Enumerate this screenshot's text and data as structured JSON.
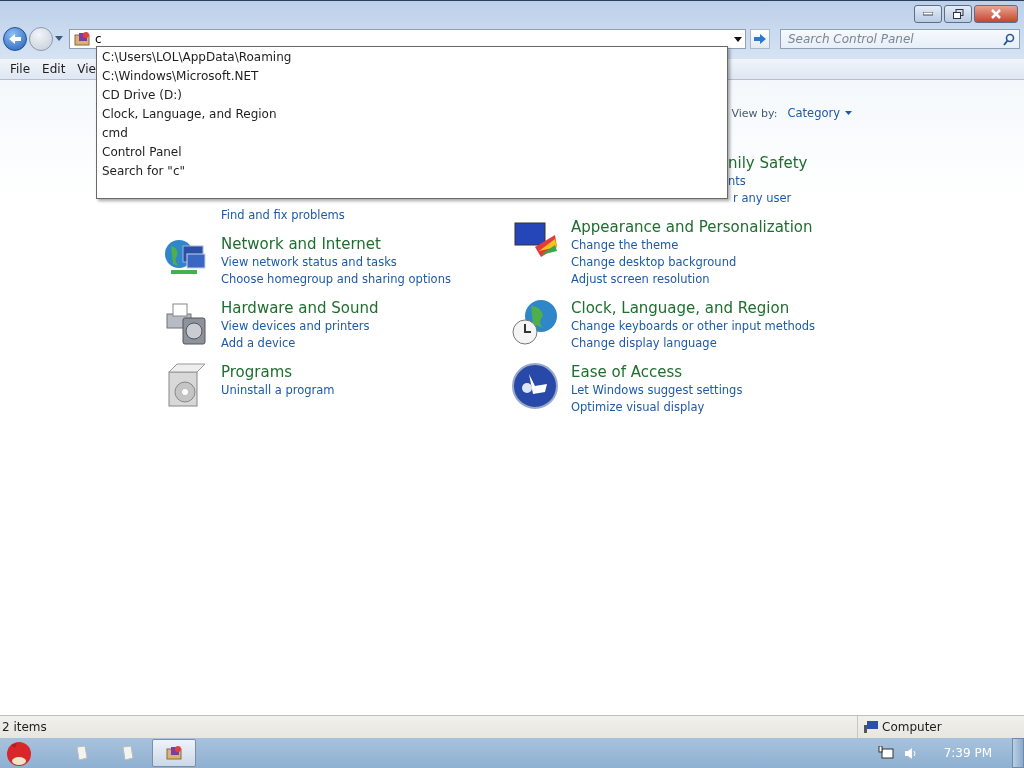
{
  "address_bar": {
    "value": "c",
    "suggestions": [
      "C:\\Users\\LOL\\AppData\\Roaming",
      "C:\\Windows\\Microsoft.NET",
      "CD Drive (D:)",
      "Clock, Language, and Region",
      "cmd",
      "Control Panel",
      "Search for \"c\""
    ]
  },
  "search": {
    "placeholder": "Search Control Panel"
  },
  "menu": [
    "File",
    "Edit",
    "Vie"
  ],
  "view_by": {
    "label": "View by:",
    "value": "Category"
  },
  "columns": [
    [
      {
        "kind": "covered",
        "links": [
          "Find and fix problems"
        ]
      },
      {
        "kind": "full",
        "title": "Network and Internet",
        "links": [
          "View network status and tasks",
          "Choose homegroup and sharing options"
        ]
      },
      {
        "kind": "full",
        "title": "Hardware and Sound",
        "links": [
          "View devices and printers",
          "Add a device"
        ]
      },
      {
        "kind": "full",
        "title": "Programs",
        "links": [
          "Uninstall a program"
        ]
      }
    ],
    [
      {
        "kind": "cut",
        "title": "nily Safety",
        "links": [
          "nts",
          "r any user"
        ]
      },
      {
        "kind": "full",
        "title": "Appearance and Personalization",
        "links": [
          "Change the theme",
          "Change desktop background",
          "Adjust screen resolution"
        ]
      },
      {
        "kind": "full",
        "title": "Clock, Language, and Region",
        "links": [
          "Change keyboards or other input methods",
          "Change display language"
        ]
      },
      {
        "kind": "full",
        "title": "Ease of Access",
        "links": [
          "Let Windows suggest settings",
          "Optimize visual display"
        ]
      }
    ]
  ],
  "status_bar": {
    "count": "2 items",
    "location": "Computer"
  },
  "taskbar": {
    "buttons": [
      {
        "kind": "doc",
        "selected": false
      },
      {
        "kind": "doc",
        "selected": false
      },
      {
        "kind": "app",
        "selected": true
      }
    ],
    "clock": "7:39 PM"
  }
}
